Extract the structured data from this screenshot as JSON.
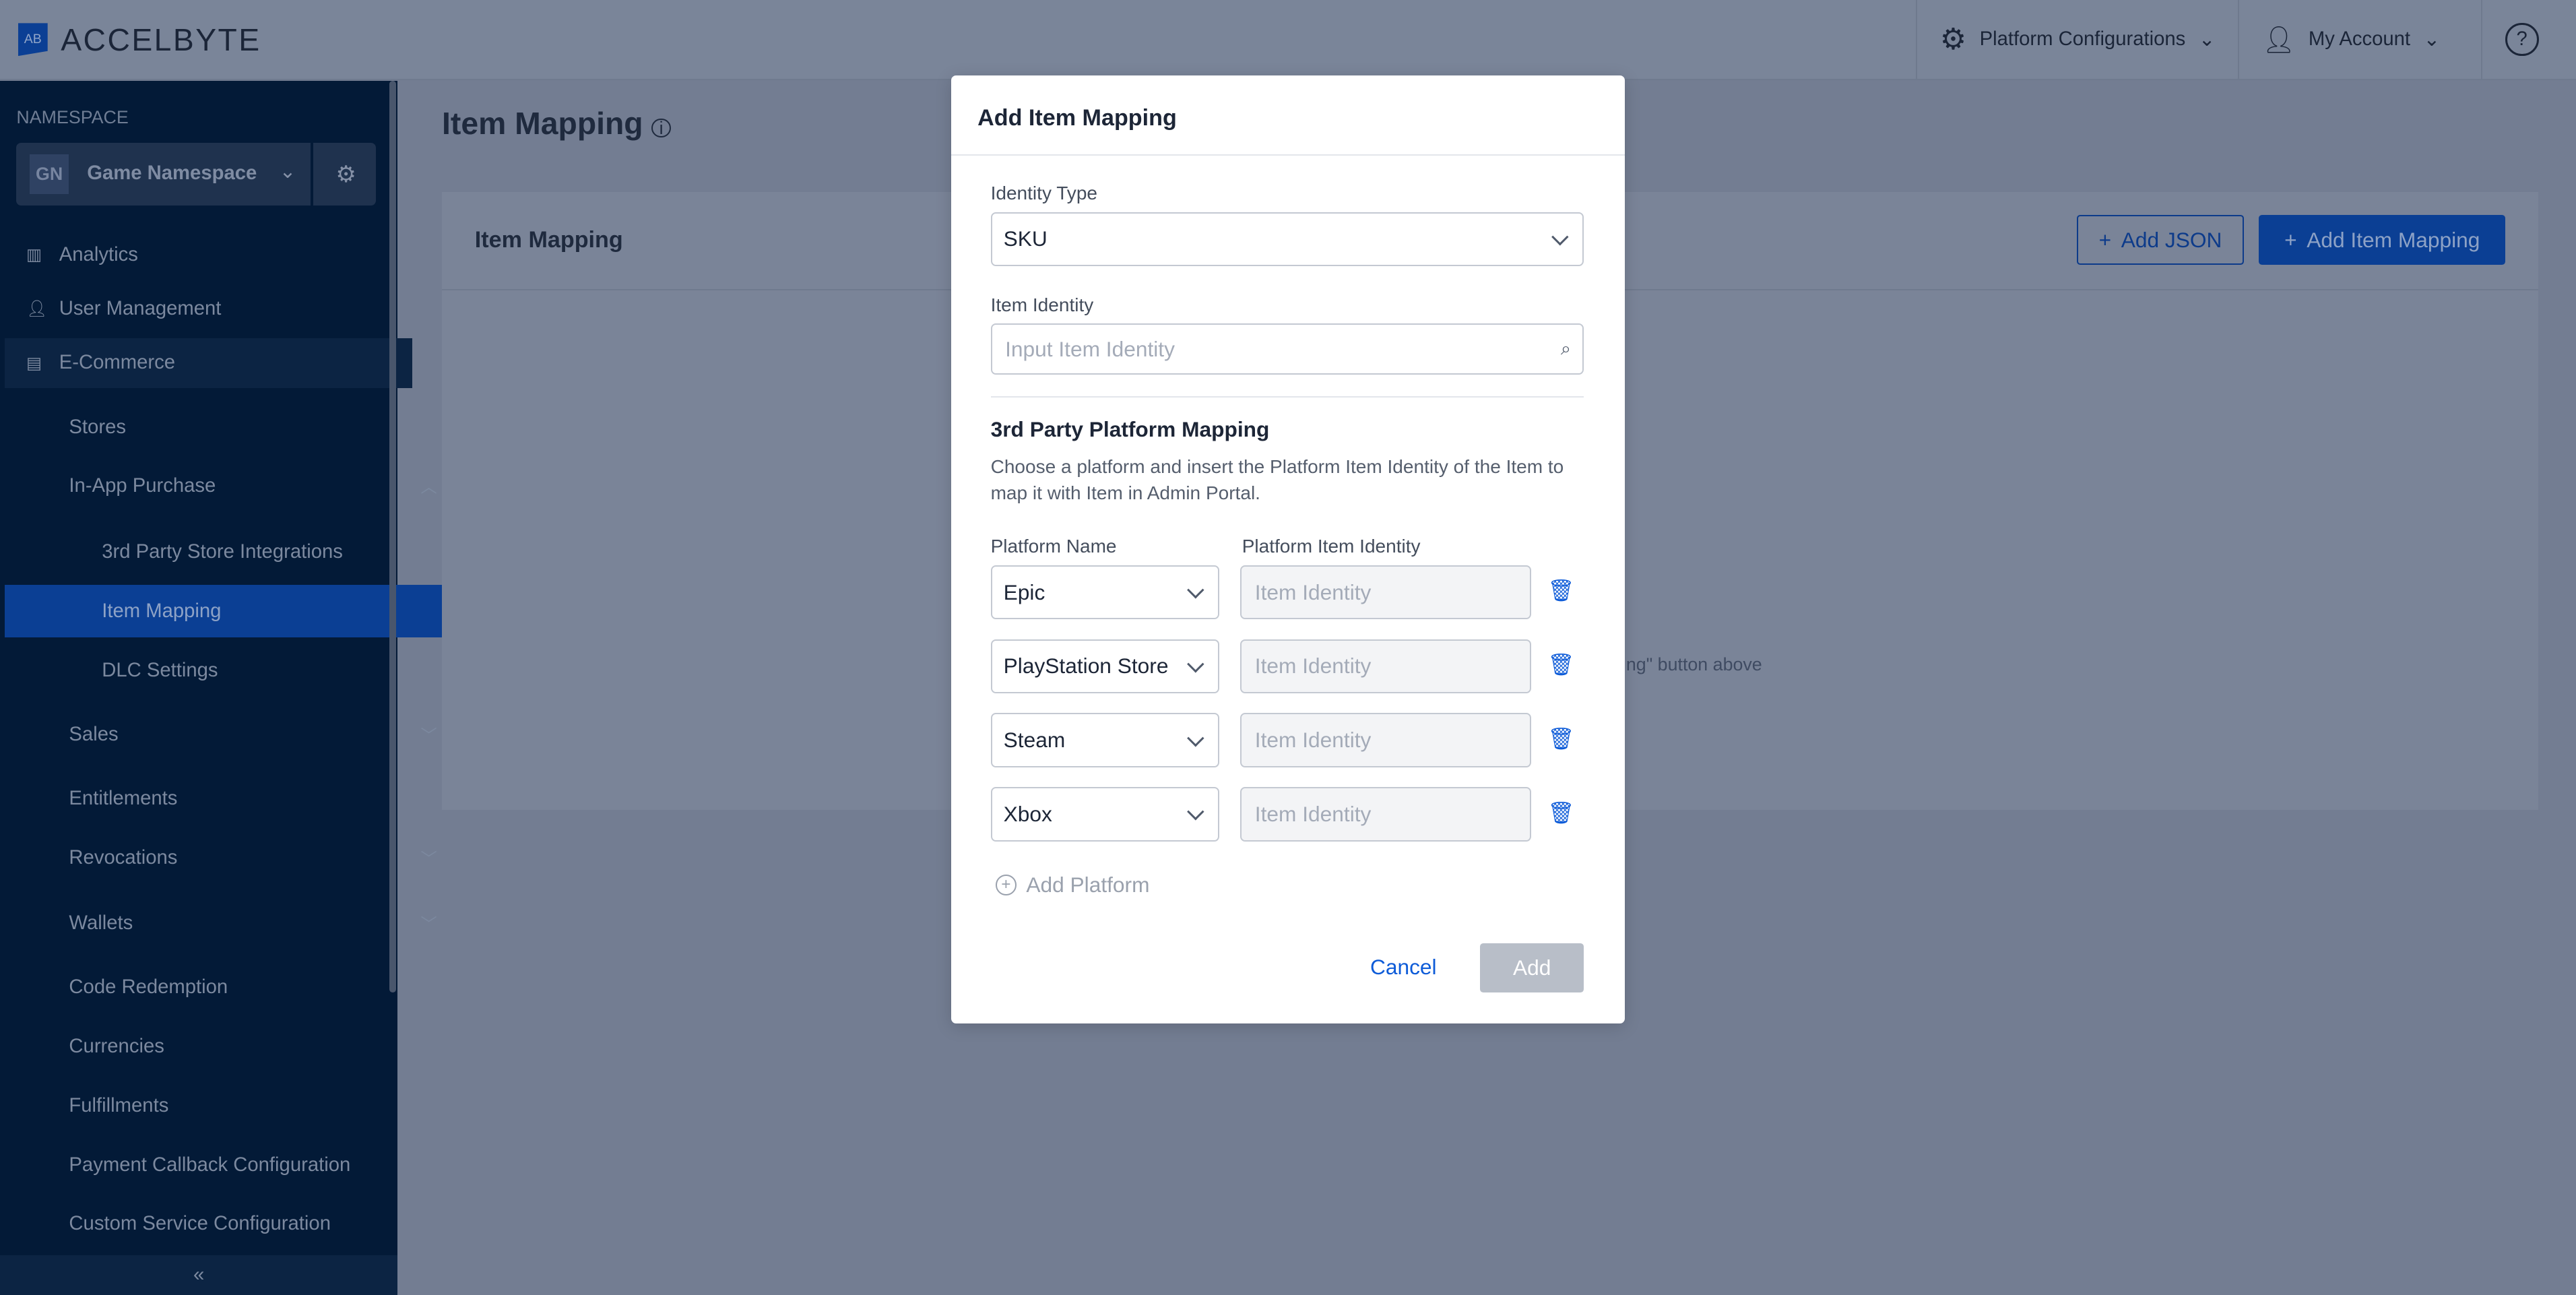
{
  "header": {
    "logo": "ACCELBYTE",
    "logo_mark": "AB",
    "platform_config": "Platform Configurations",
    "account": "My Account",
    "help_icon": "question-icon"
  },
  "sidebar": {
    "namespace_label": "NAMESPACE",
    "namespace_abbr": "GN",
    "namespace_name": "Game Namespace",
    "items": [
      {
        "label": "Analytics",
        "icon": "chart-icon"
      },
      {
        "label": "User Management",
        "icon": "user-icon"
      },
      {
        "label": "E-Commerce",
        "icon": "store-icon"
      },
      {
        "label": "Stores"
      },
      {
        "label": "In-App Purchase",
        "expanded": true
      },
      {
        "label": "3rd Party Store Integrations"
      },
      {
        "label": "Item Mapping",
        "active": true
      },
      {
        "label": "DLC Settings"
      },
      {
        "label": "Sales",
        "expandable": true
      },
      {
        "label": "Entitlements"
      },
      {
        "label": "Revocations",
        "expandable": true
      },
      {
        "label": "Wallets",
        "expandable": true
      },
      {
        "label": "Code Redemption"
      },
      {
        "label": "Currencies"
      },
      {
        "label": "Fulfillments"
      },
      {
        "label": "Payment Callback Configuration"
      },
      {
        "label": "Custom Service Configuration"
      }
    ]
  },
  "page": {
    "title": "Item Mapping",
    "card_title": "Item Mapping",
    "add_json": "Add JSON",
    "add_item_mapping": "Add Item Mapping",
    "empty_text": "apping\" button above"
  },
  "modal": {
    "title": "Add Item Mapping",
    "identity_type_label": "Identity Type",
    "identity_type_value": "SKU",
    "item_identity_label": "Item Identity",
    "item_identity_placeholder": "Input Item Identity",
    "section_title": "3rd Party Platform Mapping",
    "section_desc": "Choose a platform and insert the Platform Item Identity of the Item to map it with Item in Admin Portal.",
    "col_platform": "Platform Name",
    "col_identity": "Platform Item Identity",
    "rows": [
      {
        "platform": "Epic",
        "placeholder": "Item Identity"
      },
      {
        "platform": "PlayStation Store",
        "placeholder": "Item Identity"
      },
      {
        "platform": "Steam",
        "placeholder": "Item Identity"
      },
      {
        "platform": "Xbox",
        "placeholder": "Item Identity"
      }
    ],
    "add_platform": "Add Platform",
    "cancel": "Cancel",
    "add": "Add"
  },
  "colors": {
    "accent": "#0d5bd8",
    "sidebar": "#031a37",
    "overlay": "#737d92"
  }
}
